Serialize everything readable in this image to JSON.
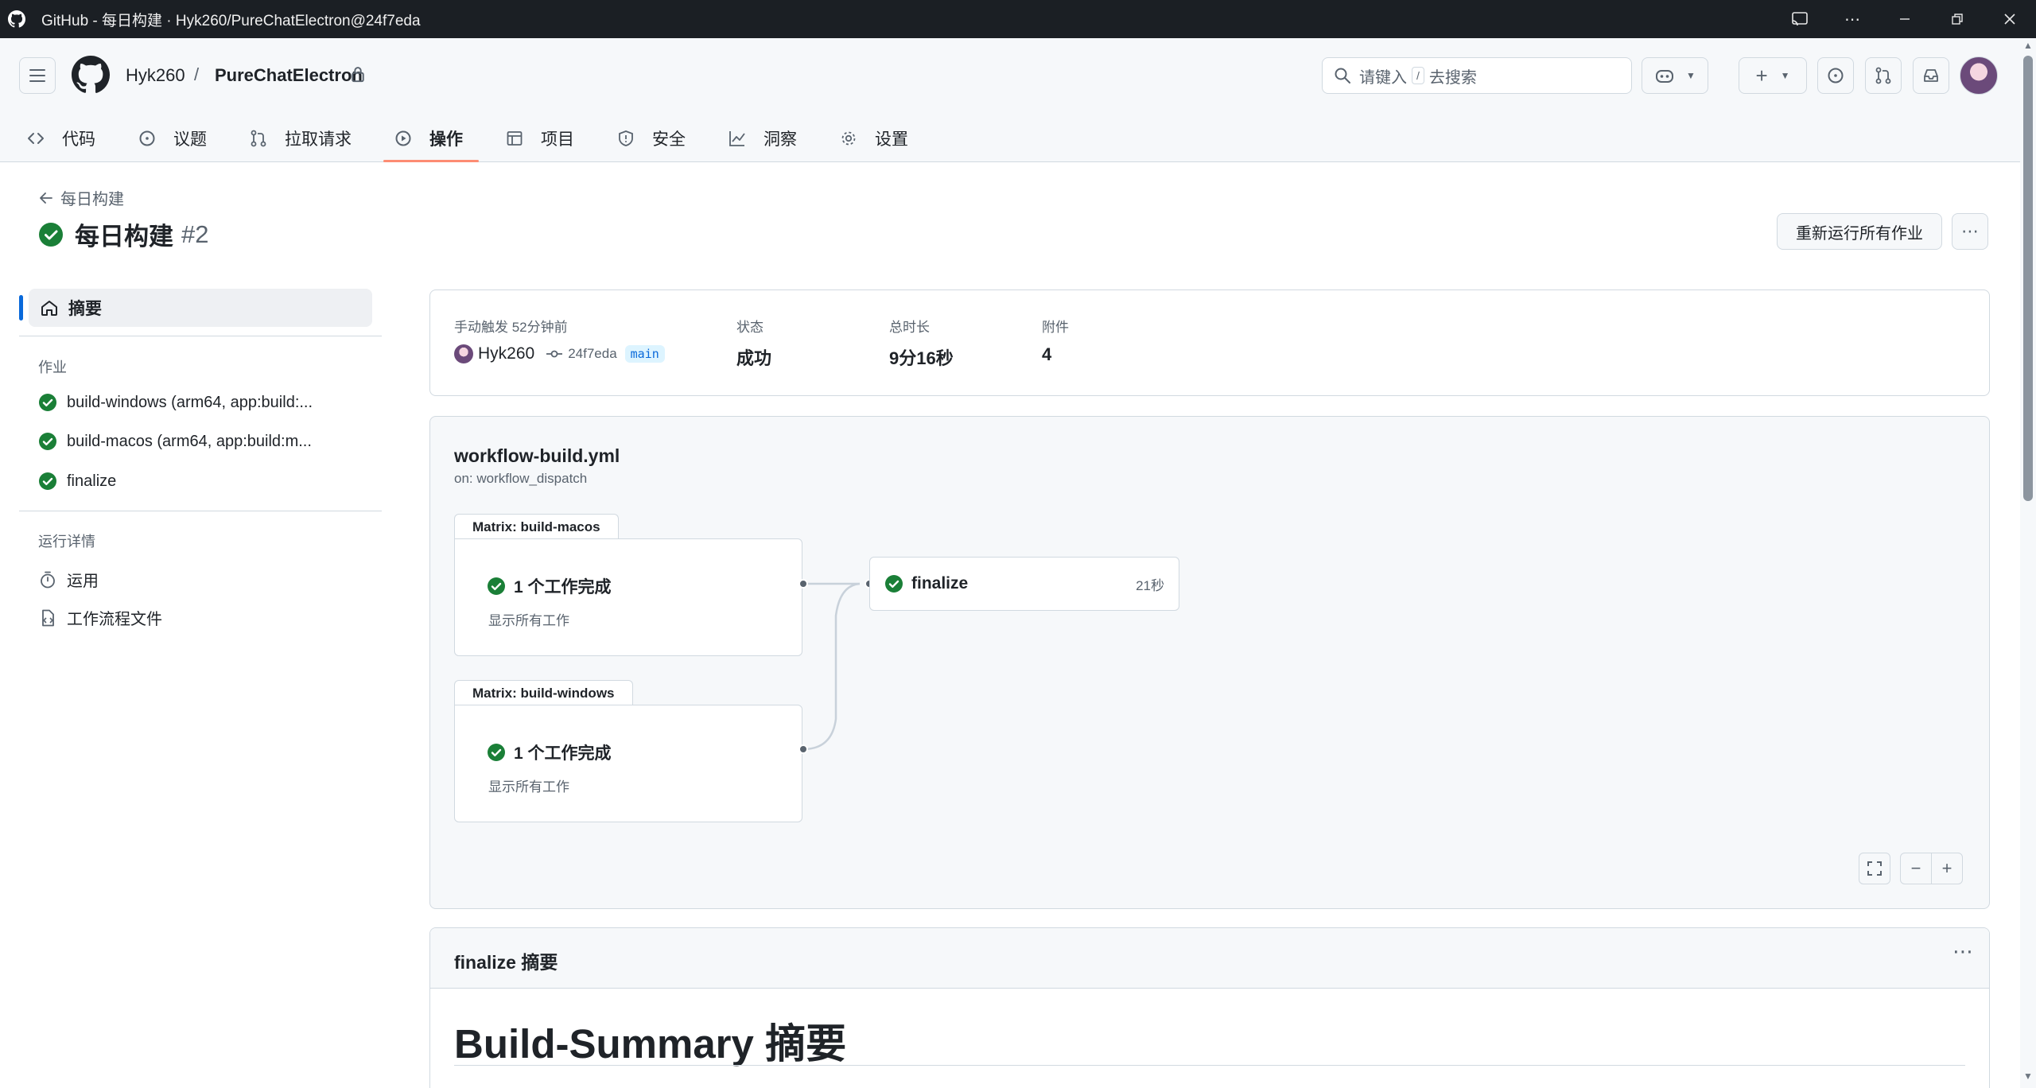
{
  "window": {
    "title": "GitHub - 每日构建 · Hyk260/PureChatElectron@24f7eda"
  },
  "header": {
    "owner": "Hyk260",
    "separator": "/",
    "repo": "PureChatElectron",
    "search_prefix": "请键入",
    "search_key": "/",
    "search_suffix": "去搜索"
  },
  "tabs": [
    {
      "label": "代码",
      "icon": "code-icon"
    },
    {
      "label": "议题",
      "icon": "issue-icon"
    },
    {
      "label": "拉取请求",
      "icon": "pull-request-icon"
    },
    {
      "label": "操作",
      "icon": "play-icon",
      "active": true
    },
    {
      "label": "项目",
      "icon": "table-icon"
    },
    {
      "label": "安全",
      "icon": "shield-icon"
    },
    {
      "label": "洞察",
      "icon": "graph-icon"
    },
    {
      "label": "设置",
      "icon": "gear-icon"
    }
  ],
  "run": {
    "back_label": "每日构建",
    "title": "每日构建",
    "number": "#2",
    "rerun_label": "重新运行所有作业"
  },
  "sidebar": {
    "summary_label": "摘要",
    "jobs_heading": "作业",
    "jobs": [
      "build-windows (arm64, app:build:...",
      "build-macos (arm64, app:build:m...",
      "finalize"
    ],
    "details_heading": "运行详情",
    "details": [
      {
        "label": "运用",
        "icon": "stopwatch-icon"
      },
      {
        "label": "工作流程文件",
        "icon": "file-code-icon"
      }
    ]
  },
  "meta": {
    "trigger_label": "手动触发 52分钟前",
    "actor": "Hyk260",
    "commit": "24f7eda",
    "branch": "main",
    "status_label": "状态",
    "status_value": "成功",
    "duration_label": "总时长",
    "duration_value": "9分16秒",
    "artifacts_label": "附件",
    "artifacts_value": "4"
  },
  "workflow": {
    "file": "workflow-build.yml",
    "on": "on: workflow_dispatch",
    "matrices": [
      {
        "tab": "Matrix: build-macos",
        "done": "1 个工作完成",
        "show_all": "显示所有工作"
      },
      {
        "tab": "Matrix: build-windows",
        "done": "1 个工作完成",
        "show_all": "显示所有工作"
      }
    ],
    "finalize": {
      "name": "finalize",
      "duration": "21秒"
    }
  },
  "summary": {
    "header": "finalize 摘要",
    "heading": "Build-Summary 摘要"
  },
  "colors": {
    "success": "#1a7f37",
    "accent": "#0969da",
    "active_tab_underline": "#fd8c73"
  }
}
